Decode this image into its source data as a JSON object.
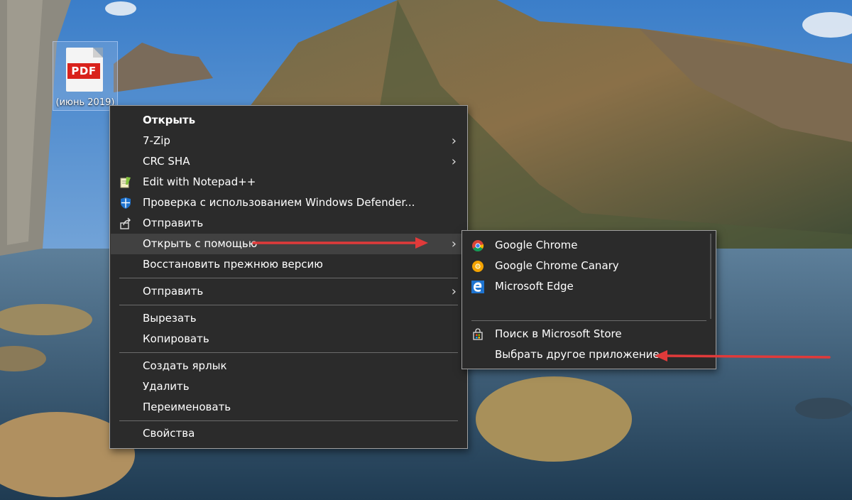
{
  "desktop": {
    "file_icon_badge": "PDF",
    "file_icon_label": "(июнь 2019)"
  },
  "context_menu": {
    "items": [
      {
        "label": "Открыть"
      },
      {
        "label": "7-Zip"
      },
      {
        "label": "CRC SHA"
      },
      {
        "label": "Edit with Notepad++"
      },
      {
        "label": "Проверка с использованием Windows Defender..."
      },
      {
        "label": "Отправить"
      },
      {
        "label": "Открыть с помощью"
      },
      {
        "label": "Восстановить прежнюю версию"
      },
      {
        "label": "Отправить"
      },
      {
        "label": "Вырезать"
      },
      {
        "label": "Копировать"
      },
      {
        "label": "Создать ярлык"
      },
      {
        "label": "Удалить"
      },
      {
        "label": "Переименовать"
      },
      {
        "label": "Свойства"
      }
    ]
  },
  "open_with_submenu": {
    "items": [
      {
        "label": "Google Chrome",
        "icon": "chrome-icon"
      },
      {
        "label": "Google Chrome Canary",
        "icon": "chrome-canary-icon"
      },
      {
        "label": "Microsoft Edge",
        "icon": "edge-icon"
      },
      {
        "label": "Поиск в Microsoft Store",
        "icon": "store-icon"
      },
      {
        "label": "Выбрать другое приложение"
      }
    ]
  },
  "annotation_color": "#e03a3a"
}
